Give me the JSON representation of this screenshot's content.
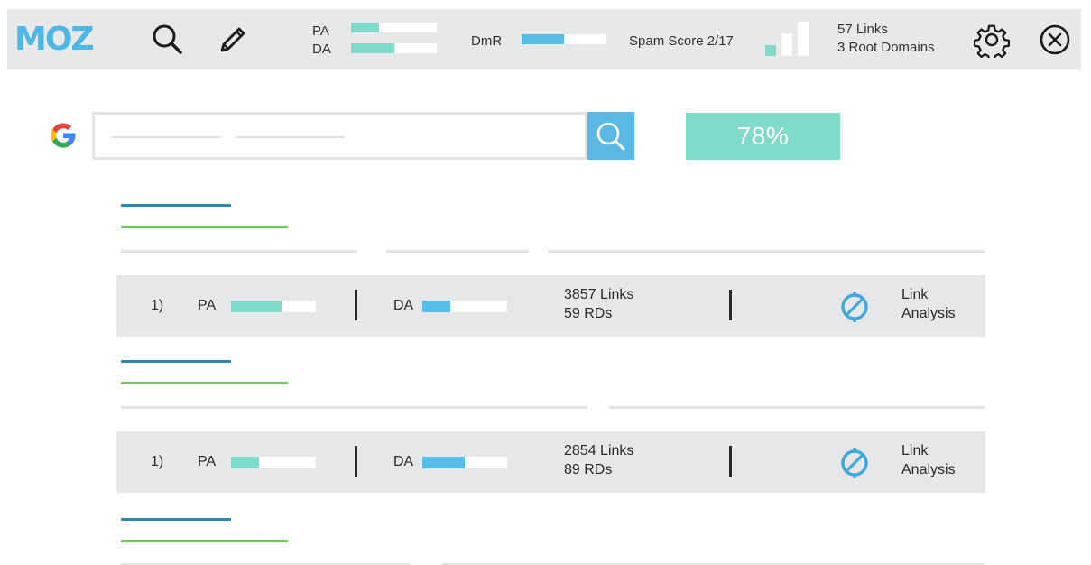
{
  "toolbar": {
    "logo": "MOZ",
    "pa_label": "PA",
    "da_label": "DA",
    "pa_value": 0.33,
    "da_value": 0.5,
    "dmr_label": "DmR",
    "dmr_value": 0.5,
    "spam_label": "Spam Score 2/17",
    "spam_level": 1,
    "links_line1": "57 Links",
    "links_line2": "3 Root Domains",
    "icons": [
      "search-icon",
      "pencil-icon",
      "gear-icon",
      "close-circle-icon"
    ]
  },
  "search": {
    "placeholder_lines": 2,
    "button_icon": "search-icon",
    "score": "78%"
  },
  "results": [
    {
      "rank": "1)",
      "pa_label": "PA",
      "pa_value": 0.6,
      "da_label": "DA",
      "da_value": 0.33,
      "links": "3857 Links",
      "rds": "59 RDs",
      "action_line1": "Link",
      "action_line2": "Analysis"
    },
    {
      "rank": "1)",
      "pa_label": "PA",
      "pa_value": 0.33,
      "da_label": "DA",
      "da_value": 0.5,
      "links": "2854 Links",
      "rds": "89 RDs",
      "action_line1": "Link",
      "action_line2": "Analysis"
    }
  ],
  "colors": {
    "toolbar_bg": "#e7e8e9",
    "moz_blue": "#4fb7e3",
    "teal": "#7fdcca",
    "blue": "#58bde6",
    "title_blue": "#2e86b8",
    "url_green": "#6ccb58",
    "result_bg": "#e6e7e8",
    "search_btn": "#5ab8e4",
    "google_blue": "#4285f4",
    "google_red": "#ea4335",
    "google_yellow": "#fbbc05",
    "google_green": "#34a853"
  }
}
